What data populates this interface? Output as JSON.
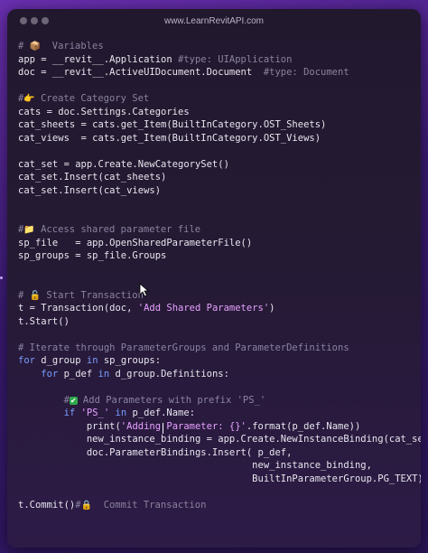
{
  "window": {
    "site": "www.LearnRevitAPI.com"
  },
  "code": {
    "lines": [
      [
        {
          "t": "# ",
          "c": "cm"
        },
        {
          "e": "📦",
          "k": "pkg"
        },
        {
          "t": "  Variables",
          "c": "cm"
        }
      ],
      [
        {
          "t": "app = __revit__.Application "
        },
        {
          "t": "#type: UIApplication",
          "c": "cm"
        }
      ],
      [
        {
          "t": "doc = __revit__.ActiveUIDocument.Document  "
        },
        {
          "t": "#type: Document",
          "c": "cm"
        }
      ],
      [],
      [
        {
          "t": "#",
          "c": "cm"
        },
        {
          "e": "👉",
          "k": "hand"
        },
        {
          "t": " Create Category Set",
          "c": "cm"
        }
      ],
      [
        {
          "t": "cats = doc.Settings.Categories"
        }
      ],
      [
        {
          "t": "cat_sheets = cats.get_Item(BuiltInCategory.OST_Sheets)"
        }
      ],
      [
        {
          "t": "cat_views  = cats.get_Item(BuiltInCategory.OST_Views)"
        }
      ],
      [],
      [
        {
          "t": "cat_set = app.Create.NewCategorySet()"
        }
      ],
      [
        {
          "t": "cat_set.Insert(cat_sheets)"
        }
      ],
      [
        {
          "t": "cat_set.Insert(cat_views)"
        }
      ],
      [],
      [],
      [
        {
          "t": "#",
          "c": "cm"
        },
        {
          "e": "📁",
          "k": "folder"
        },
        {
          "t": " Access shared parameter file",
          "c": "cm"
        }
      ],
      [
        {
          "t": "sp_file   = app.OpenSharedParameterFile()"
        }
      ],
      [
        {
          "t": "sp_groups = sp_file.Groups"
        }
      ],
      [],
      [],
      [
        {
          "t": "# ",
          "c": "cm"
        },
        {
          "e": "🔓",
          "k": "lock"
        },
        {
          "t": " Start Transaction",
          "c": "cm"
        }
      ],
      [
        {
          "t": "t = Transaction(doc, "
        },
        {
          "t": "'Add Shared Parameters'",
          "c": "st"
        },
        {
          "t": ")"
        }
      ],
      [
        {
          "t": "t.Start()"
        }
      ],
      [],
      [
        {
          "t": "# Iterate through ParameterGroups and ParameterDefinitions",
          "c": "cm"
        }
      ],
      [
        {
          "t": "for",
          "c": "kw"
        },
        {
          "t": " d_group "
        },
        {
          "t": "in",
          "c": "kw"
        },
        {
          "t": " sp_groups:"
        }
      ],
      [
        {
          "t": "    "
        },
        {
          "t": "for",
          "c": "kw"
        },
        {
          "t": " p_def "
        },
        {
          "t": "in",
          "c": "kw"
        },
        {
          "t": " d_group.Definitions:"
        }
      ],
      [],
      [
        {
          "t": "        #",
          "c": "cm"
        },
        {
          "e": "✔",
          "k": "check"
        },
        {
          "t": " Add Parameters with prefix 'PS_'",
          "c": "cm"
        }
      ],
      [
        {
          "t": "        "
        },
        {
          "t": "if",
          "c": "kw"
        },
        {
          "t": " "
        },
        {
          "t": "'PS_'",
          "c": "st"
        },
        {
          "t": " "
        },
        {
          "t": "in",
          "c": "kw"
        },
        {
          "t": " p_def.Name:"
        }
      ],
      [
        {
          "t": "            print("
        },
        {
          "t": "'Adding Parameter: {}'",
          "c": "st"
        },
        {
          "t": ".format(p_def.Name))"
        }
      ],
      [
        {
          "t": "            new_instance_binding = app.Create.NewInstanceBinding(cat_set)"
        }
      ],
      [
        {
          "t": "            doc.ParameterBindings.Insert( p_def,"
        }
      ],
      [
        {
          "t": "                                         new_instance_binding,"
        }
      ],
      [
        {
          "t": "                                         BuiltInParameterGroup.PG_TEXT)"
        }
      ],
      [],
      [
        {
          "t": "t.Commit()"
        },
        {
          "t": "#",
          "c": "cm"
        },
        {
          "e": "🔒",
          "k": "lock"
        },
        {
          "t": "  Commit Transaction",
          "c": "cm"
        }
      ]
    ]
  }
}
